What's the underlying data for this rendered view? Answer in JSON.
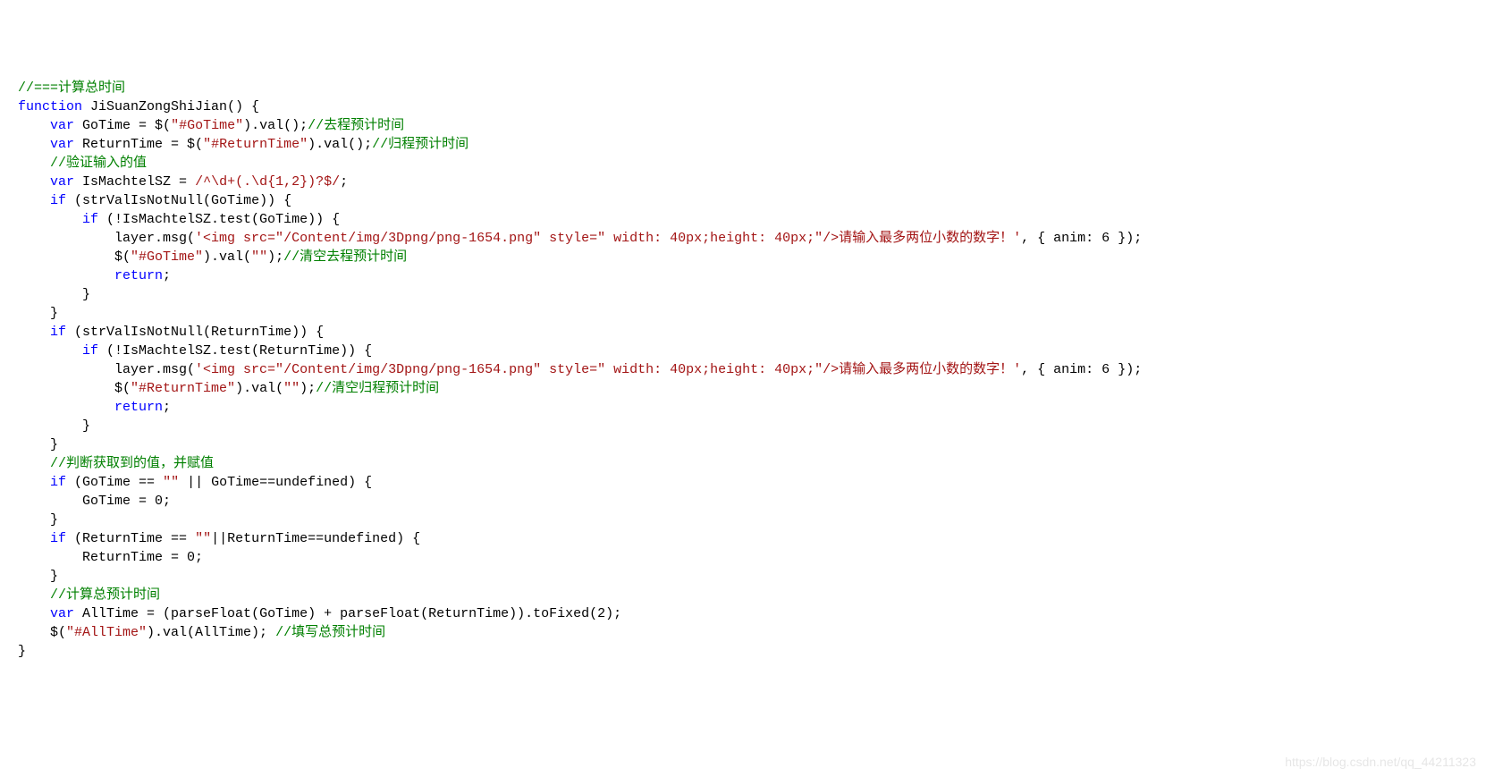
{
  "watermark": "https://blog.csdn.net/qq_44211323",
  "lines": [
    [
      {
        "t": "//===计算总时间",
        "c": "c"
      }
    ],
    [
      {
        "t": "function",
        "c": "k"
      },
      {
        "t": " JiSuanZongShiJian() {"
      }
    ],
    [
      {
        "t": "    "
      },
      {
        "t": "var",
        "c": "k"
      },
      {
        "t": " GoTime = $("
      },
      {
        "t": "\"#GoTime\"",
        "c": "s"
      },
      {
        "t": ").val();"
      },
      {
        "t": "//去程预计时间",
        "c": "c"
      }
    ],
    [
      {
        "t": "    "
      },
      {
        "t": "var",
        "c": "k"
      },
      {
        "t": " ReturnTime = $("
      },
      {
        "t": "\"#ReturnTime\"",
        "c": "s"
      },
      {
        "t": ").val();"
      },
      {
        "t": "//归程预计时间",
        "c": "c"
      }
    ],
    [
      {
        "t": "    "
      },
      {
        "t": "//验证输入的值",
        "c": "c"
      }
    ],
    [
      {
        "t": "    "
      },
      {
        "t": "var",
        "c": "k"
      },
      {
        "t": " IsMachtelSZ = "
      },
      {
        "t": "/^\\d+(.\\d{1,2})?$/",
        "c": "r"
      },
      {
        "t": ";"
      }
    ],
    [
      {
        "t": "    "
      },
      {
        "t": "if",
        "c": "k"
      },
      {
        "t": " (strValIsNotNull(GoTime)) {"
      }
    ],
    [
      {
        "t": "        "
      },
      {
        "t": "if",
        "c": "k"
      },
      {
        "t": " (!IsMachtelSZ.test(GoTime)) {"
      }
    ],
    [
      {
        "t": "            layer.msg("
      },
      {
        "t": "'<img src=\"/Content/img/3Dpng/png-1654.png\" style=\" width: 40px;height: 40px;\"/>请输入最多两位小数的数字！'",
        "c": "s"
      },
      {
        "t": ", { anim: 6 });"
      }
    ],
    [
      {
        "t": "            $("
      },
      {
        "t": "\"#GoTime\"",
        "c": "s"
      },
      {
        "t": ").val("
      },
      {
        "t": "\"\"",
        "c": "s"
      },
      {
        "t": ");"
      },
      {
        "t": "//清空去程预计时间",
        "c": "c"
      }
    ],
    [
      {
        "t": "            "
      },
      {
        "t": "return",
        "c": "k"
      },
      {
        "t": ";"
      }
    ],
    [
      {
        "t": "        }"
      }
    ],
    [
      {
        "t": "    }"
      }
    ],
    [
      {
        "t": "    "
      },
      {
        "t": "if",
        "c": "k"
      },
      {
        "t": " (strValIsNotNull(ReturnTime)) {"
      }
    ],
    [
      {
        "t": "        "
      },
      {
        "t": "if",
        "c": "k"
      },
      {
        "t": " (!IsMachtelSZ.test(ReturnTime)) {"
      }
    ],
    [
      {
        "t": "            layer.msg("
      },
      {
        "t": "'<img src=\"/Content/img/3Dpng/png-1654.png\" style=\" width: 40px;height: 40px;\"/>请输入最多两位小数的数字！'",
        "c": "s"
      },
      {
        "t": ", { anim: 6 });"
      }
    ],
    [
      {
        "t": "            $("
      },
      {
        "t": "\"#ReturnTime\"",
        "c": "s"
      },
      {
        "t": ").val("
      },
      {
        "t": "\"\"",
        "c": "s"
      },
      {
        "t": ");"
      },
      {
        "t": "//清空归程预计时间",
        "c": "c"
      }
    ],
    [
      {
        "t": "            "
      },
      {
        "t": "return",
        "c": "k"
      },
      {
        "t": ";"
      }
    ],
    [
      {
        "t": "        }"
      }
    ],
    [
      {
        "t": "    }"
      }
    ],
    [
      {
        "t": "    "
      },
      {
        "t": "//判断获取到的值，并赋值",
        "c": "c"
      }
    ],
    [
      {
        "t": "    "
      },
      {
        "t": "if",
        "c": "k"
      },
      {
        "t": " (GoTime == "
      },
      {
        "t": "\"\"",
        "c": "s"
      },
      {
        "t": " || GoTime==undefined) {"
      }
    ],
    [
      {
        "t": "        GoTime = 0;"
      }
    ],
    [
      {
        "t": "    }"
      }
    ],
    [
      {
        "t": "    "
      },
      {
        "t": "if",
        "c": "k"
      },
      {
        "t": " (ReturnTime == "
      },
      {
        "t": "\"\"",
        "c": "s"
      },
      {
        "t": "||ReturnTime==undefined) {"
      }
    ],
    [
      {
        "t": "        ReturnTime = 0;"
      }
    ],
    [
      {
        "t": "    }"
      }
    ],
    [
      {
        "t": "    "
      },
      {
        "t": "//计算总预计时间",
        "c": "c"
      }
    ],
    [
      {
        "t": "    "
      },
      {
        "t": "var",
        "c": "k"
      },
      {
        "t": " AllTime = (parseFloat(GoTime) + parseFloat(ReturnTime)).toFixed(2);"
      }
    ],
    [
      {
        "t": "    $("
      },
      {
        "t": "\"#AllTime\"",
        "c": "s"
      },
      {
        "t": ").val(AllTime); "
      },
      {
        "t": "//填写总预计时间",
        "c": "c"
      }
    ],
    [
      {
        "t": "}"
      }
    ]
  ]
}
